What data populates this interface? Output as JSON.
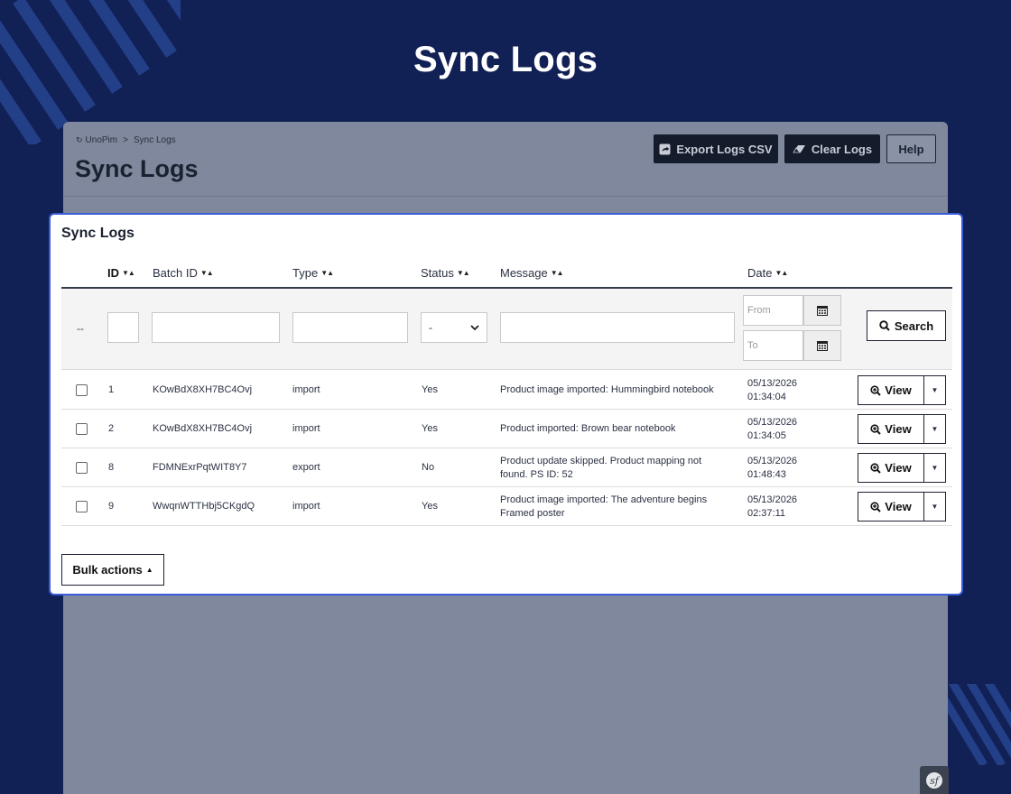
{
  "hero": {
    "title": "Sync Logs"
  },
  "breadcrumb": {
    "root": "UnoPim",
    "separator": ">",
    "current": "Sync Logs"
  },
  "page": {
    "title": "Sync Logs"
  },
  "toolbar": {
    "export_label": "Export Logs CSV",
    "clear_label": "Clear Logs",
    "help_label": "Help"
  },
  "card": {
    "title": "Sync Logs"
  },
  "table": {
    "headers": {
      "id": "ID",
      "batch_id": "Batch ID",
      "type": "Type",
      "status": "Status",
      "message": "Message",
      "date": "Date"
    },
    "filters": {
      "row_marker": "--",
      "status_selected": "-",
      "from_placeholder": "From",
      "to_placeholder": "To",
      "search_label": "Search"
    },
    "rows": [
      {
        "id": "1",
        "batch_id": "KOwBdX8XH7BC4Ovj",
        "type": "import",
        "status": "Yes",
        "message": "Product image imported: Hummingbird notebook",
        "date": "05/13/2026",
        "time": "01:34:04",
        "action": "View"
      },
      {
        "id": "2",
        "batch_id": "KOwBdX8XH7BC4Ovj",
        "type": "import",
        "status": "Yes",
        "message": "Product imported: Brown bear notebook",
        "date": "05/13/2026",
        "time": "01:34:05",
        "action": "View"
      },
      {
        "id": "8",
        "batch_id": "FDMNExrPqtWIT8Y7",
        "type": "export",
        "status": "No",
        "message": "Product update skipped. Product mapping not found. PS ID: 52",
        "date": "05/13/2026",
        "time": "01:48:43",
        "action": "View"
      },
      {
        "id": "9",
        "batch_id": "WwqnWTTHbj5CKgdQ",
        "type": "import",
        "status": "Yes",
        "message": "Product image imported: The adventure begins Framed poster",
        "date": "05/13/2026",
        "time": "02:37:11",
        "action": "View"
      }
    ]
  },
  "bulk": {
    "label": "Bulk actions"
  },
  "colors": {
    "background": "#112155",
    "accent": "#3a5bd9",
    "panel": "#7f889c"
  }
}
